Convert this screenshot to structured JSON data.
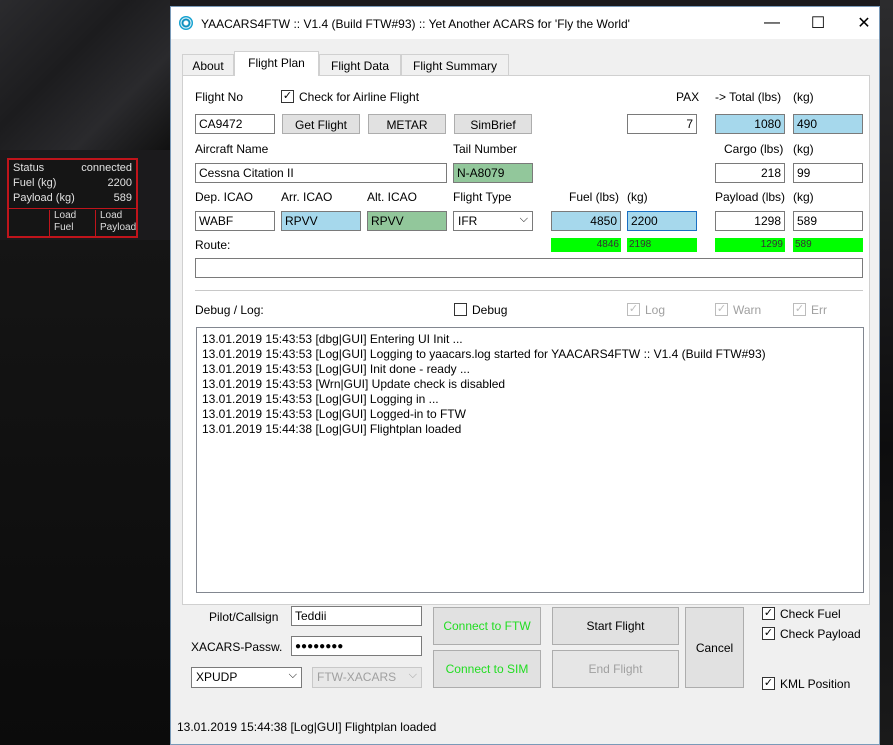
{
  "overlay": {
    "status_label": "Status",
    "status_value": "connected",
    "fuel_label": "Fuel (kg)",
    "fuel_value": "2200",
    "payload_label": "Payload (kg)",
    "payload_value": "589",
    "load_fuel": [
      "Load",
      "Fuel"
    ],
    "load_payload": [
      "Load",
      "Payload"
    ]
  },
  "window": {
    "title": "YAACARS4FTW :: V1.4 (Build FTW#93) :: Yet Another ACARS for 'Fly the World'",
    "minimize": "—",
    "maximize": "☐",
    "close": "✕"
  },
  "tabs": [
    {
      "label": "About",
      "active": false
    },
    {
      "label": "Flight Plan",
      "active": true
    },
    {
      "label": "Flight Data",
      "active": false
    },
    {
      "label": "Flight Summary",
      "active": false
    }
  ],
  "form": {
    "flight_no_label": "Flight No",
    "check_airline_label": "Check for Airline Flight",
    "check_airline_checked": true,
    "flight_no": "CA9472",
    "get_flight": "Get Flight",
    "metar": "METAR",
    "simbrief": "SimBrief",
    "pax_label": "PAX",
    "pax": "7",
    "total_lbs_label": "->  Total (lbs)",
    "kg_label": "(kg)",
    "total_lbs": "1080",
    "total_kg": "490",
    "aircraft_name_label": "Aircraft Name",
    "aircraft_name": "Cessna Citation II",
    "tail_number_label": "Tail Number",
    "tail_number": "N-A8079",
    "cargo_lbs_label": "Cargo (lbs)",
    "cargo_lbs": "218",
    "cargo_kg": "99",
    "dep_label": "Dep. ICAO",
    "arr_label": "Arr. ICAO",
    "alt_label": "Alt. ICAO",
    "flight_type_label": "Flight Type",
    "dep": "WABF",
    "arr": "RPVV",
    "alt": "RPVV",
    "flight_type": "IFR",
    "fuel_lbs_label": "Fuel (lbs)",
    "fuel_lbs": "4850",
    "fuel_kg": "2200",
    "payload_lbs_label": "Payload (lbs)",
    "payload_lbs": "1298",
    "payload_kg": "589",
    "fuel_actual_lbs": "4846",
    "fuel_actual_kg": "2198",
    "payload_actual_lbs": "1299",
    "payload_actual_kg": "589",
    "route_label": "Route:",
    "route": ""
  },
  "debug": {
    "label": "Debug / Log:",
    "debug_checkbox": "Debug",
    "log": "Log",
    "warn": "Warn",
    "err": "Err",
    "lines": [
      "13.01.2019 15:43:53 [dbg|GUI] Entering UI Init ...",
      "13.01.2019 15:43:53 [Log|GUI] Logging to yaacars.log started for YAACARS4FTW :: V1.4 (Build FTW#93)",
      "13.01.2019 15:43:53 [Log|GUI] Init done - ready ...",
      "13.01.2019 15:43:53 [Wrn|GUI] Update check is disabled",
      "13.01.2019 15:43:53 [Log|GUI] Logging in ...",
      "13.01.2019 15:43:53 [Log|GUI] Logged-in to FTW",
      "13.01.2019 15:44:38 [Log|GUI] Flightplan loaded"
    ]
  },
  "bottom": {
    "pilot_label": "Pilot/Callsign",
    "pilot": "Teddii",
    "pass_label": "XACARS-Passw.",
    "pass": "●●●●●●●●",
    "protocol": "XPUDP",
    "target": "FTW-XACARS",
    "connect_ftw": "Connect to FTW",
    "connect_sim": "Connect to SIM",
    "start_flight": "Start Flight",
    "end_flight": "End Flight",
    "cancel": "Cancel",
    "check_fuel": "Check Fuel",
    "check_payload": "Check Payload",
    "kml_position": "KML Position",
    "status": "13.01.2019 15:44:38 [Log|GUI] Flightplan loaded"
  }
}
